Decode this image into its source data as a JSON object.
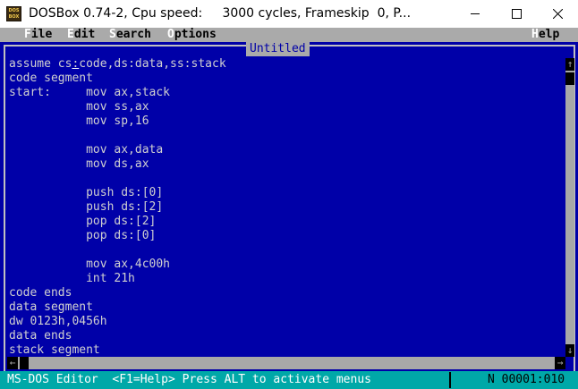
{
  "window": {
    "title": "DOSBox 0.74-2, Cpu speed:     3000 cycles, Frameskip  0, P...",
    "icon_text_top": "DOS",
    "icon_text_bottom": "BOX"
  },
  "menubar": {
    "file": {
      "hot": "F",
      "rest": "ile"
    },
    "edit": {
      "hot": "E",
      "rest": "dit"
    },
    "search": {
      "hot": "S",
      "rest": "earch"
    },
    "options": {
      "hot": "O",
      "rest": "ptions"
    },
    "help": {
      "hot": "H",
      "rest": "elp"
    }
  },
  "editor": {
    "document_title": "Untitled",
    "first_line": {
      "before": "assume cs",
      "cursor": ":",
      "after": "code,ds:data,ss:stack"
    },
    "lines": [
      "code segment",
      "start:     mov ax,stack",
      "           mov ss,ax",
      "           mov sp,16",
      "",
      "           mov ax,data",
      "           mov ds,ax",
      "",
      "           push ds:[0]",
      "           push ds:[2]",
      "           pop ds:[2]",
      "           pop ds:[0]",
      "",
      "           mov ax,4c00h",
      "           int 21h",
      "code ends",
      "data segment",
      "dw 0123h,0456h",
      "data ends",
      "stack segment"
    ]
  },
  "statusbar": {
    "left": "MS-DOS Editor  <F1=Help> Press ALT to activate menus",
    "right": "N 00001:010"
  },
  "colors": {
    "editor_bg": "#0000a8",
    "editor_text": "#d0d0d0",
    "menubar_bg": "#aaaaaa",
    "statusbar_bg": "#00a8a8"
  },
  "icons": {
    "minimize": "minimize-icon",
    "maximize": "maximize-icon",
    "close": "close-icon",
    "app": "dosbox-app-icon"
  }
}
